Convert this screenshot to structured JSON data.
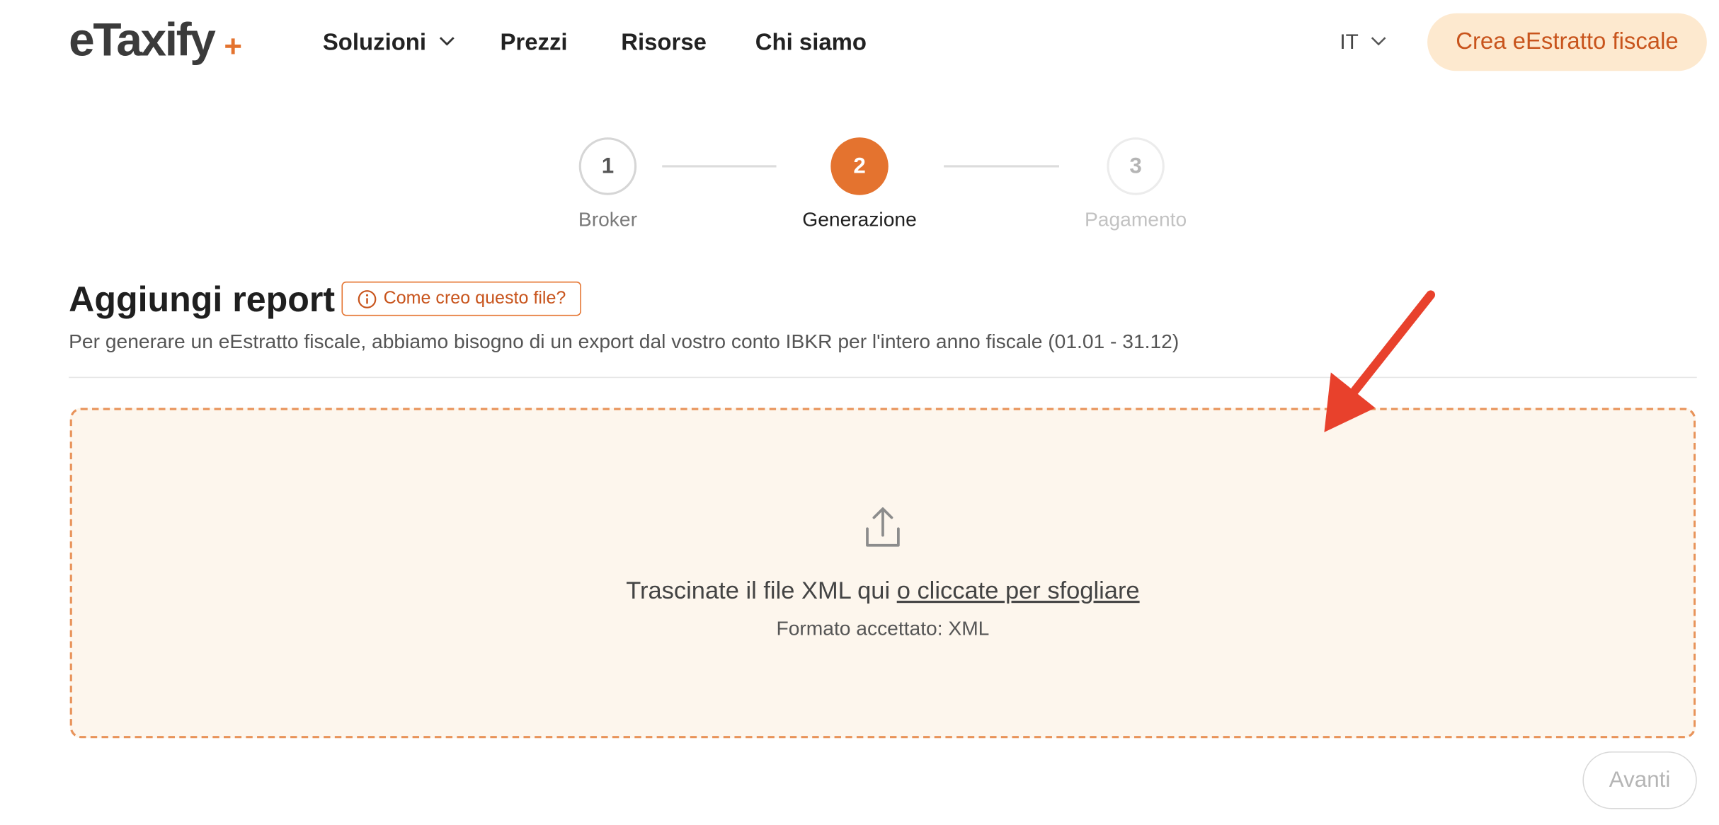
{
  "header": {
    "logo_text": "eTaxify",
    "logo_plus": "+",
    "nav": [
      {
        "label": "Soluzioni",
        "has_dropdown": true
      },
      {
        "label": "Prezzi"
      },
      {
        "label": "Risorse"
      },
      {
        "label": "Chi siamo"
      }
    ],
    "language": "IT",
    "cta_label": "Crea eEstratto fiscale"
  },
  "stepper": {
    "steps": [
      {
        "number": "1",
        "label": "Broker",
        "state": "completed"
      },
      {
        "number": "2",
        "label": "Generazione",
        "state": "active"
      },
      {
        "number": "3",
        "label": "Pagamento",
        "state": "pending"
      }
    ]
  },
  "section": {
    "title": "Aggiungi report",
    "help_label": "Come creo questo file?",
    "help_icon": "info-icon",
    "subtitle": "Per generare un eEstratto fiscale, abbiamo bisogno di un export dal vostro conto IBKR per l'intero anno fiscale (01.01 - 31.12)"
  },
  "dropzone": {
    "icon": "upload-icon",
    "text": "Trascinate il file XML qui",
    "browse_link": "o cliccate per sfogliare",
    "accepted_format": "Formato accettato: XML"
  },
  "footer": {
    "next_label": "Avanti"
  },
  "colors": {
    "accent": "#e4732f",
    "cta_bg": "#fde9cf",
    "cta_text": "#c8541c",
    "dropzone_bg": "#fdf6ed",
    "arrow": "#e8412c"
  }
}
